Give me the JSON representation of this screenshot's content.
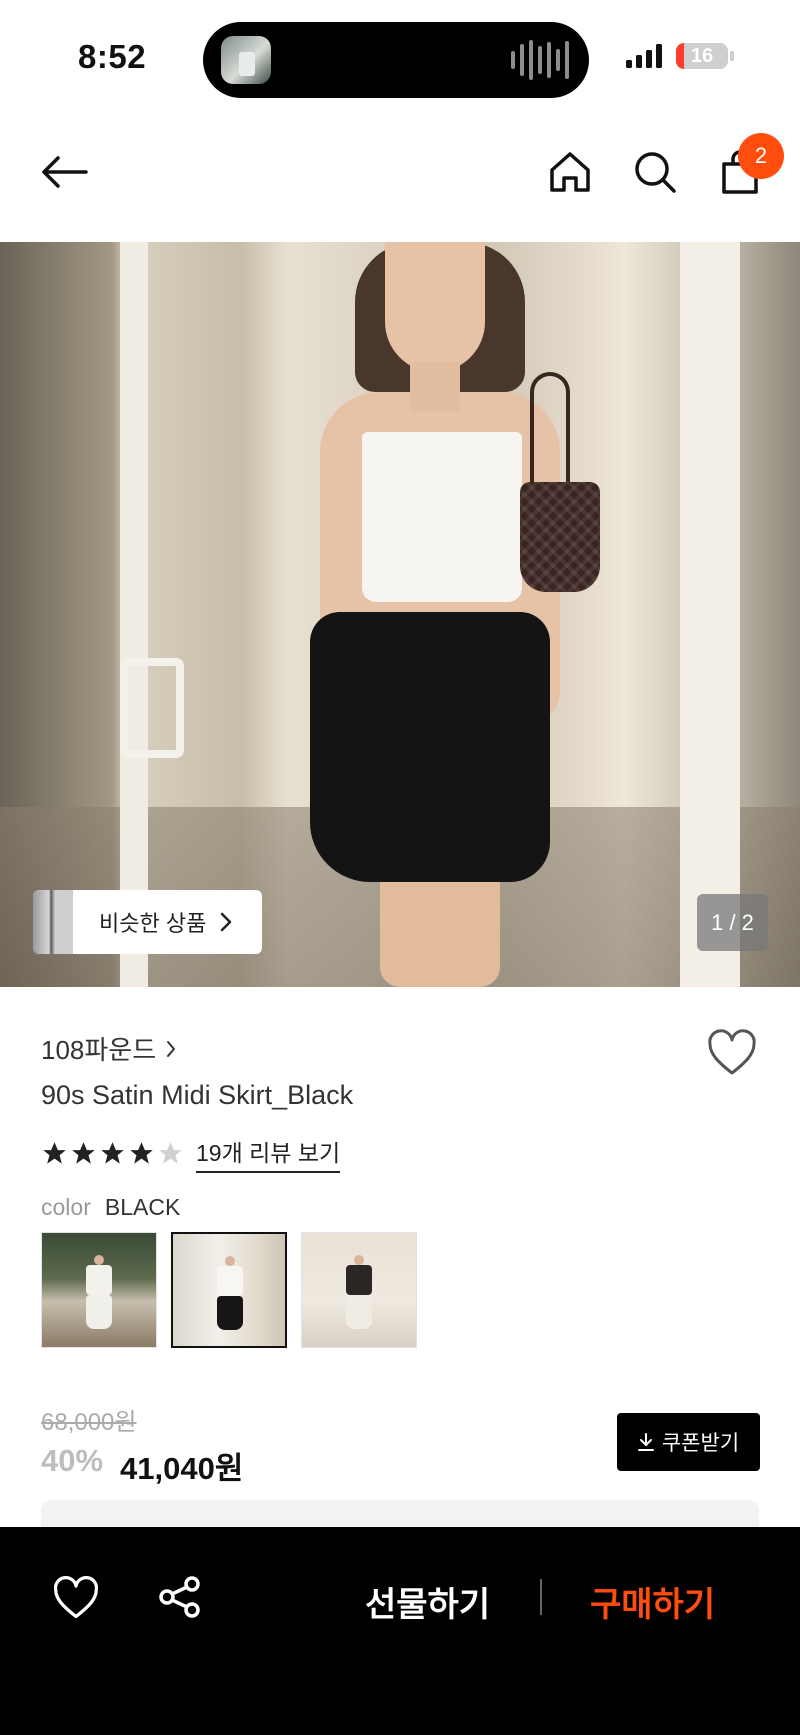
{
  "status_bar": {
    "time": "8:52",
    "battery": "16"
  },
  "header": {
    "cart_count": "2"
  },
  "hero": {
    "similar_label": "비슷한 상품",
    "image_counter": "1 / 2"
  },
  "product": {
    "brand": "108파운드",
    "name": "90s Satin Midi Skirt_Black",
    "rating": 4,
    "reviews_label": "19개 리뷰 보기",
    "color_label": "color",
    "color_value": "BLACK",
    "original_price": "68,000원",
    "discount": "40%",
    "price": "41,040원",
    "coupon_label": "쿠폰받기"
  },
  "bottom_bar": {
    "gift_label": "선물하기",
    "buy_label": "구매하기"
  },
  "colors": {
    "accent": "#ff4d0d",
    "black": "#000000"
  }
}
